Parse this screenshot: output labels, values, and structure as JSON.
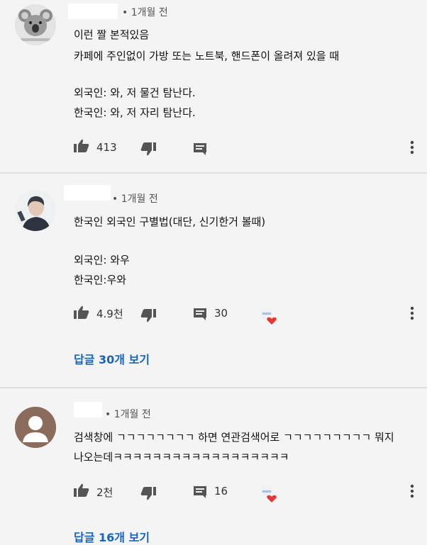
{
  "comments": [
    {
      "time": "1개월 전",
      "lines": [
        "이런 짤 본적있음",
        "카페에 주인없이 가방 또는 노트북, 핸드폰이 올려져 있을 때",
        "",
        "외국인: 와, 저 물건 탐난다.",
        "한국인: 와, 저 자리 탐난다."
      ],
      "likes": "413",
      "replies": "",
      "avatar_icon": "koala-avatar-icon"
    },
    {
      "time": "1개월 전",
      "lines": [
        "한국인 외국인 구별법(대단, 신기한거 볼때)",
        "",
        "외국인: 와우",
        "한국인:우와"
      ],
      "likes": "4.9천",
      "replies": "30",
      "view_replies": "답글 30개 보기",
      "avatar_icon": "person-photo-avatar-icon"
    },
    {
      "time": "1개월 전",
      "lines": [
        "검색창에 ㄱㄱㄱㄱㄱㄱㄱㄱ 하면 연관검색어로 ㄱㄱㄱㄱㄱㄱㄱㄱㄱ 뭐지",
        "나오는데ㅋㅋㅋㅋㅋㅋㅋㅋㅋㅋㅋㅋㅋㅋㅋㅋㅋㅋ"
      ],
      "likes": "2천",
      "replies": "16",
      "view_replies": "답글 16개 보기",
      "avatar_icon": "default-user-avatar-icon"
    }
  ],
  "colors": {
    "link": "#1565c0",
    "heart": "#e53935",
    "background": "#f4f4f4"
  }
}
